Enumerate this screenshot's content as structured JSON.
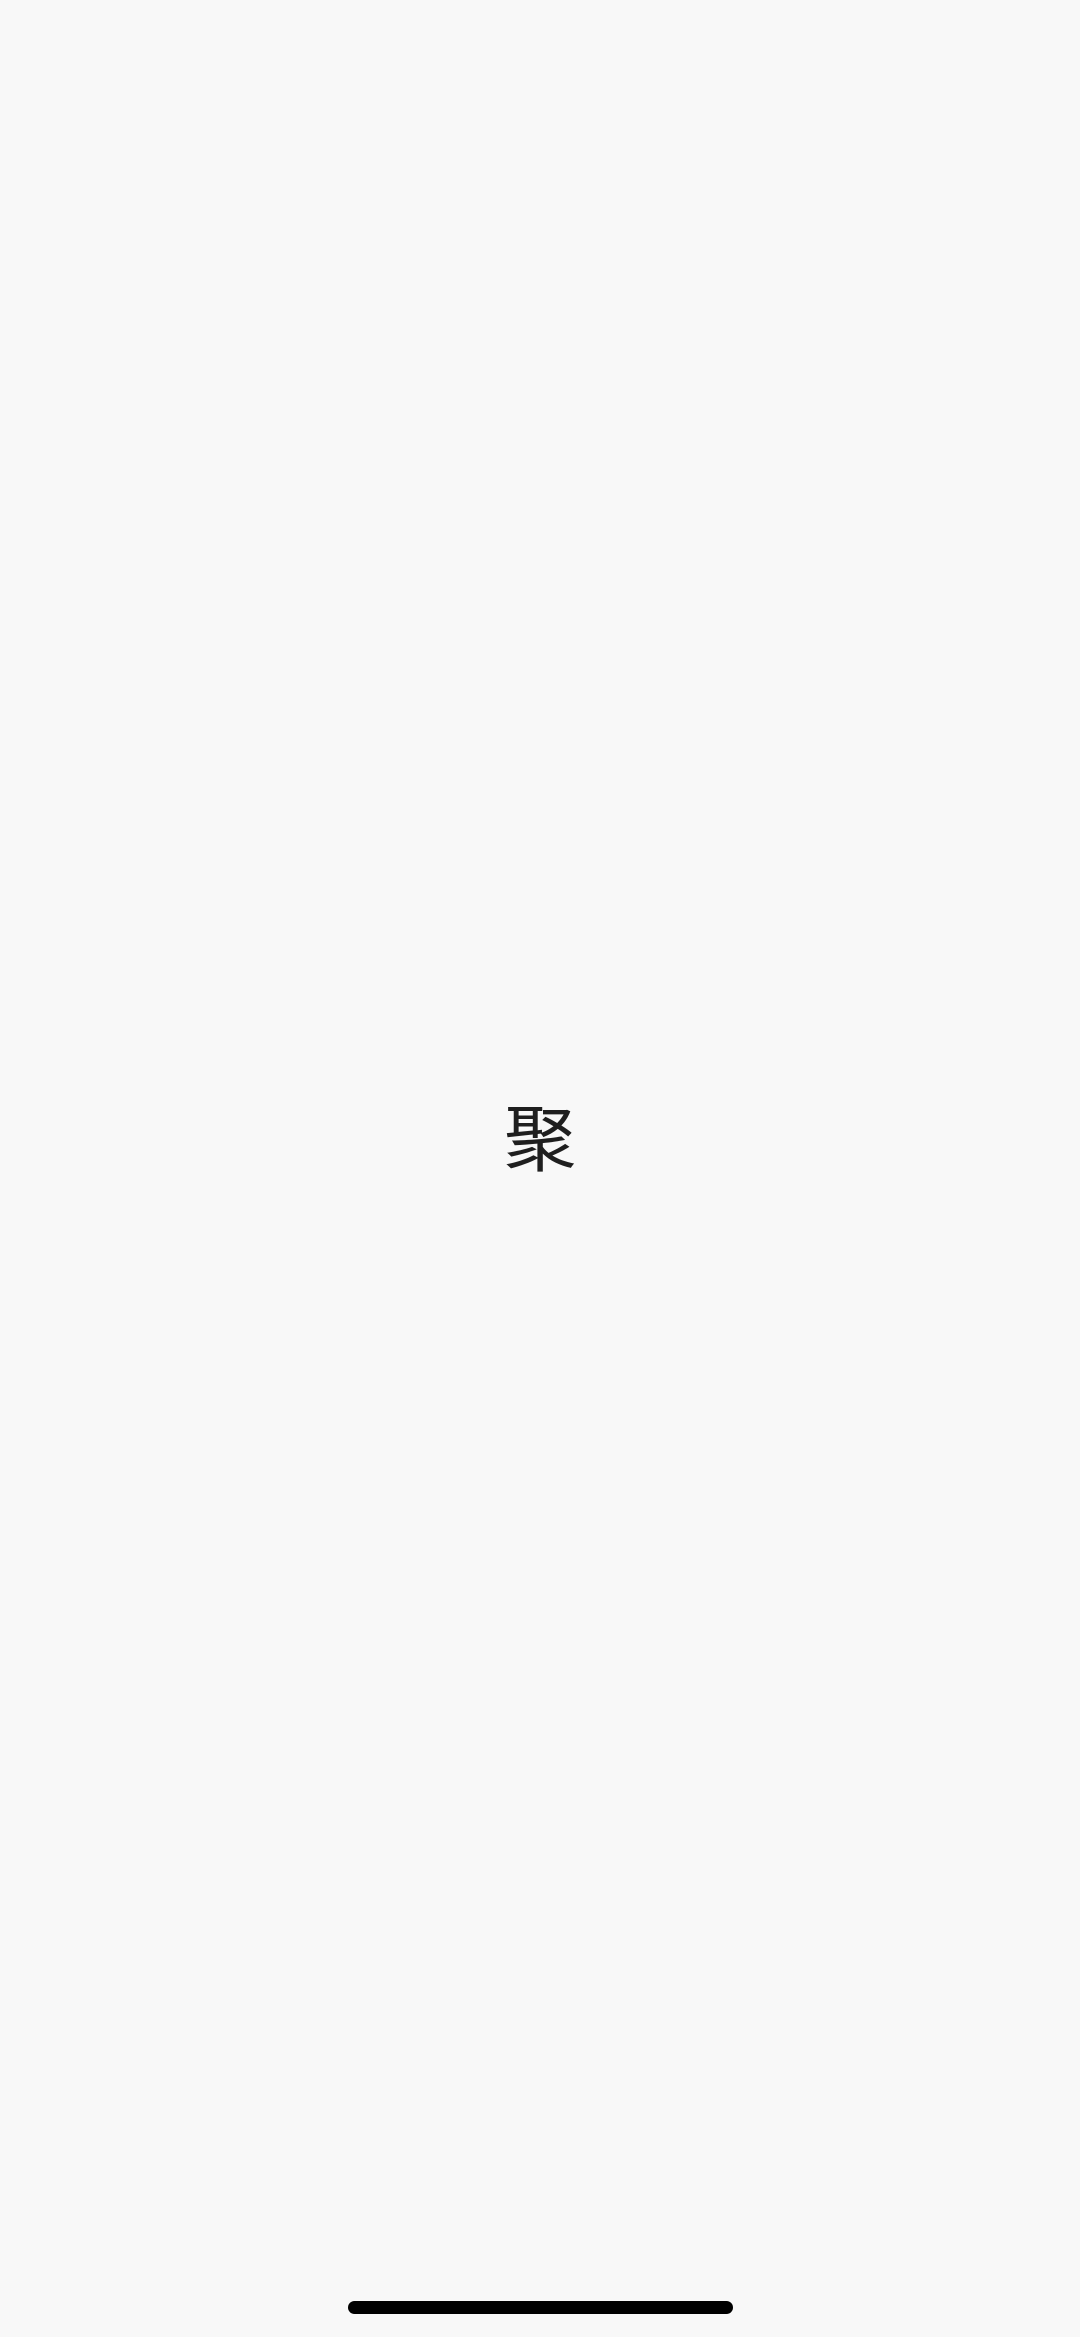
{
  "splash": {
    "logo_text": "聚"
  },
  "system": {
    "home_indicator": "home-indicator"
  },
  "colors": {
    "background": "#f8f8f8",
    "logo_text": "#1f1f1f",
    "home_indicator": "#000000"
  }
}
